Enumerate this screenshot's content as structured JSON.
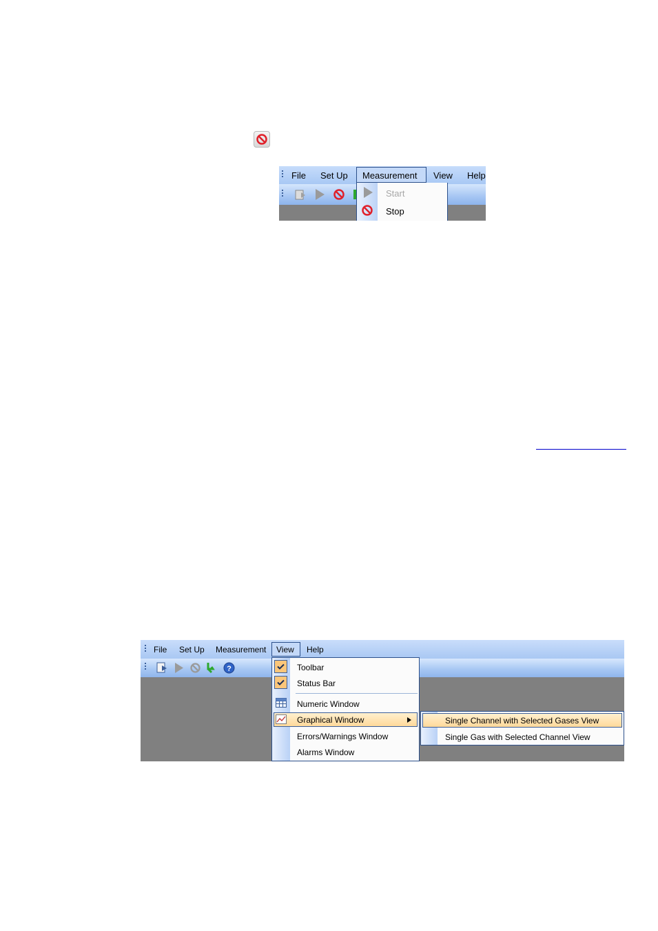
{
  "screenshot1": {
    "menu": [
      "File",
      "Set Up",
      "Measurement",
      "View",
      "Help"
    ],
    "dropdown": [
      {
        "label": "Start",
        "enabled": false
      },
      {
        "label": "Stop",
        "enabled": true
      }
    ]
  },
  "screenshot2": {
    "menu": [
      "File",
      "Set Up",
      "Measurement",
      "View",
      "Help"
    ],
    "view_menu": [
      {
        "label": "Toolbar",
        "checked": true
      },
      {
        "label": "Status Bar",
        "checked": true
      },
      {
        "label": "Numeric Window"
      },
      {
        "label": "Graphical Window",
        "has_submenu": true,
        "highlighted": true
      },
      {
        "label": "Errors/Warnings Window"
      },
      {
        "label": "Alarms Window"
      }
    ],
    "graphical_submenu": [
      {
        "label": "Single Channel with Selected Gases View",
        "highlighted": true
      },
      {
        "label": "Single Gas with Selected Channel View"
      }
    ]
  },
  "colors": {
    "stop_red": "#e0202a",
    "menu_highlight": "#ffd99a",
    "menubar_blue": "#b7d1f7",
    "app_background": "#808080"
  }
}
